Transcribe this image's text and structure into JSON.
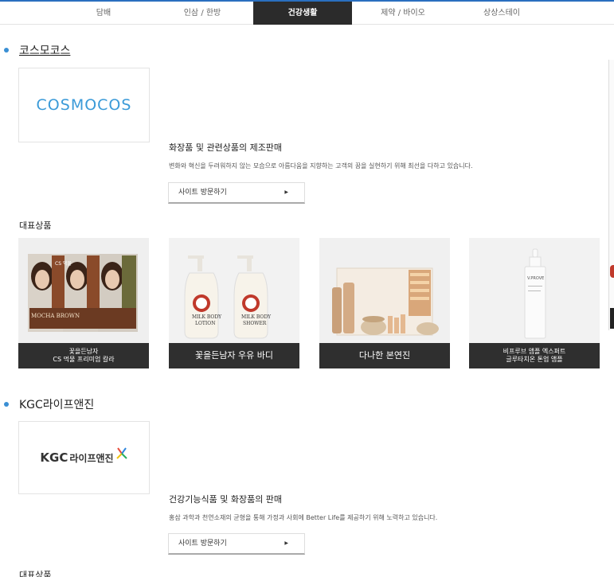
{
  "tabs": [
    {
      "label": "담배",
      "active": false
    },
    {
      "label": "인삼 / 한방",
      "active": false
    },
    {
      "label": "건강생활",
      "active": true
    },
    {
      "label": "제약 / 바이오",
      "active": false
    },
    {
      "label": "상상스테이",
      "active": false
    }
  ],
  "colors": {
    "accent": "#2a6fbf",
    "bullet": "#3a8fd4",
    "active_tab": "#2b2b2b",
    "caption_bg": "#2f2f2f"
  },
  "sections": [
    {
      "title": "코스모코스",
      "logo_text": "COSMOCOS",
      "headline": "화장품 및 관련상품의 제조판매",
      "description": "변화와 혁신을 두려워하지 않는 모습으로 아름다움을 지향하는 고객의 꿈을 실현하기 위해 최선을 다하고 있습니다.",
      "visit_label": "사이트 방문하기",
      "rep_label": "대표상품",
      "products": [
        {
          "caption_line1": "꽃을든남자",
          "caption_line2": "CS 먹물 프리미엄 칼라"
        },
        {
          "caption_line1": "꽃을든남자 우유 바디",
          "caption_line2": ""
        },
        {
          "caption_line1": "다나한 본연진",
          "caption_line2": ""
        },
        {
          "caption_line1": "비프루브 앰플 엑스퍼트",
          "caption_line2": "글루타치온 톤업 앰플"
        }
      ]
    },
    {
      "title": "KGC라이프앤진",
      "logo_text_kgc": "KGC",
      "logo_text_rest": "라이프앤진",
      "headline": "건강기능식품 및 화장품의 판매",
      "description": "홍삼 과학과 천연소재의 균형을 통해 가정과 사회에 Better Life를 제공하기 위해 노력하고 있습니다.",
      "visit_label": "사이트 방문하기",
      "rep_label": "대표상품"
    }
  ],
  "product_image_text": {
    "cs_box": "CS 먹물",
    "cs_box_sub": "MOCHA BROWN",
    "milk_bottle": "MILK BODY",
    "milk_lotion": "LOTION",
    "milk_shower": "SHOWER",
    "vprove": "V.PROVE"
  }
}
